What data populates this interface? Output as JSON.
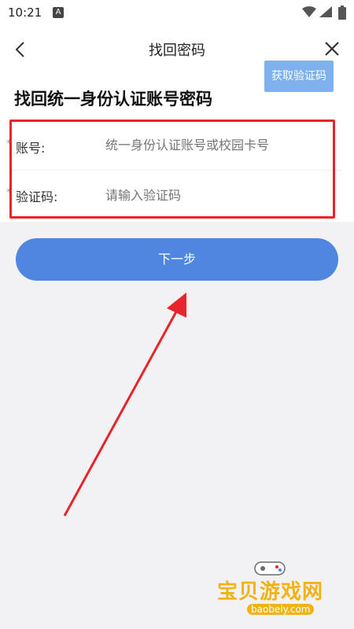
{
  "status_bar": {
    "time": "10:21",
    "notification_glyph": "A"
  },
  "navbar": {
    "title": "找回密码",
    "back_icon": "chevron-left-icon",
    "close_icon": "close-icon"
  },
  "page": {
    "heading": "找回统一身份认证账号密码"
  },
  "form": {
    "account": {
      "required_mark": "*",
      "label": "账号:",
      "placeholder": "统一身份认证账号或校园卡号"
    },
    "code": {
      "required_mark": "*",
      "label": "验证码:",
      "placeholder": "请输入验证码",
      "button_label": "获取验证码"
    }
  },
  "next_button": {
    "label": "下一步"
  },
  "annotation": {
    "highlight_color": "#e8242a",
    "arrow_color": "#e8242a"
  },
  "watermark": {
    "title": "宝贝游戏网",
    "subtitle": "baobeiy.com"
  },
  "colors": {
    "primary": "#4f86e0",
    "code_button": "#7fb1ec",
    "background": "#f2f2f4"
  }
}
